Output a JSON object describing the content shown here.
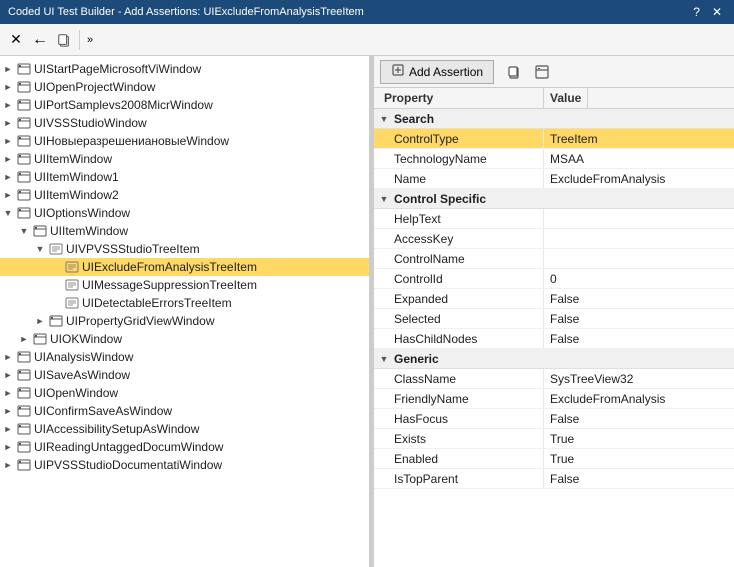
{
  "titleBar": {
    "text": "Coded UI Test Builder - Add Assertions: UIExcludeFromAnalysisTreeItem",
    "helpBtn": "?",
    "closeBtn": "✕"
  },
  "toolbar": {
    "buttons": [
      {
        "name": "cross-icon",
        "icon": "✕",
        "tooltip": "Delete"
      },
      {
        "name": "back-icon",
        "icon": "←",
        "tooltip": "Back"
      },
      {
        "name": "add-icon",
        "icon": "📋",
        "tooltip": "Add"
      },
      {
        "name": "more-icon",
        "icon": "»",
        "tooltip": "More"
      }
    ]
  },
  "treePanel": {
    "items": [
      {
        "id": "t1",
        "label": "UIStartPageMicrosoftViWindow",
        "indent": 0,
        "expander": "►",
        "icon": "win"
      },
      {
        "id": "t2",
        "label": "UIOpenProjectWindow",
        "indent": 0,
        "expander": "►",
        "icon": "win"
      },
      {
        "id": "t3",
        "label": "UIPortSamplevs2008MicrWindow",
        "indent": 0,
        "expander": "►",
        "icon": "win"
      },
      {
        "id": "t4",
        "label": "UIVSSStudioWindow",
        "indent": 0,
        "expander": "►",
        "icon": "win"
      },
      {
        "id": "t5",
        "label": "UIНовыеразрешениановыеWindow",
        "indent": 0,
        "expander": "►",
        "icon": "win"
      },
      {
        "id": "t6",
        "label": "UIItemWindow",
        "indent": 0,
        "expander": "►",
        "icon": "win"
      },
      {
        "id": "t7",
        "label": "UIItemWindow1",
        "indent": 0,
        "expander": "►",
        "icon": "win"
      },
      {
        "id": "t8",
        "label": "UIItemWindow2",
        "indent": 0,
        "expander": "►",
        "icon": "win"
      },
      {
        "id": "t9",
        "label": "UIOptionsWindow",
        "indent": 0,
        "expander": "▼",
        "icon": "win"
      },
      {
        "id": "t10",
        "label": "UIItemWindow",
        "indent": 1,
        "expander": "▼",
        "icon": "win"
      },
      {
        "id": "t11",
        "label": "UIVPVSSStudioTreeItem",
        "indent": 2,
        "expander": "▼",
        "icon": "item"
      },
      {
        "id": "t12",
        "label": "UIExcludeFromAnalysisTreeItem",
        "indent": 3,
        "expander": "",
        "icon": "item",
        "selected": true
      },
      {
        "id": "t13",
        "label": "UIMessageSuppressionTreeItem",
        "indent": 3,
        "expander": "",
        "icon": "item"
      },
      {
        "id": "t14",
        "label": "UIDetectableErrorsTreeItem",
        "indent": 3,
        "expander": "",
        "icon": "item"
      },
      {
        "id": "t15",
        "label": "UIPropertyGridViewWindow",
        "indent": 2,
        "expander": "►",
        "icon": "win"
      },
      {
        "id": "t16",
        "label": "UIOKWindow",
        "indent": 1,
        "expander": "►",
        "icon": "win"
      },
      {
        "id": "t17",
        "label": "UIAnalysisWindow",
        "indent": 0,
        "expander": "►",
        "icon": "win"
      },
      {
        "id": "t18",
        "label": "UISaveAsWindow",
        "indent": 0,
        "expander": "►",
        "icon": "win"
      },
      {
        "id": "t19",
        "label": "UIOpenWindow",
        "indent": 0,
        "expander": "►",
        "icon": "win"
      },
      {
        "id": "t20",
        "label": "UIConfirmSaveAsWindow",
        "indent": 0,
        "expander": "►",
        "icon": "win"
      },
      {
        "id": "t21",
        "label": "UIAccessibilitySetupAsWindow",
        "indent": 0,
        "expander": "►",
        "icon": "win"
      },
      {
        "id": "t22",
        "label": "UIReadingUntaggedDocumWindow",
        "indent": 0,
        "expander": "►",
        "icon": "win"
      },
      {
        "id": "t23",
        "label": "UIPVSSStudioDocumentatiWindow",
        "indent": 0,
        "expander": "►",
        "icon": "win"
      }
    ]
  },
  "rightPanel": {
    "addAssertionLabel": "Add Assertion",
    "columns": [
      {
        "label": "Property"
      },
      {
        "label": "Value"
      }
    ],
    "groups": [
      {
        "name": "Search",
        "expander": "▼",
        "rows": [
          {
            "property": "ControlType",
            "value": "TreeItem",
            "highlighted": true
          },
          {
            "property": "TechnologyName",
            "value": "MSAA",
            "highlighted": false
          },
          {
            "property": "Name",
            "value": "ExcludeFromAnalysis",
            "highlighted": false
          }
        ]
      },
      {
        "name": "Control Specific",
        "expander": "▼",
        "rows": [
          {
            "property": "HelpText",
            "value": "",
            "highlighted": false
          },
          {
            "property": "AccessKey",
            "value": "",
            "highlighted": false
          },
          {
            "property": "ControlName",
            "value": "",
            "highlighted": false
          },
          {
            "property": "ControlId",
            "value": "0",
            "highlighted": false
          },
          {
            "property": "Expanded",
            "value": "False",
            "highlighted": false
          },
          {
            "property": "Selected",
            "value": "False",
            "highlighted": false
          },
          {
            "property": "HasChildNodes",
            "value": "False",
            "highlighted": false
          }
        ]
      },
      {
        "name": "Generic",
        "expander": "▼",
        "rows": [
          {
            "property": "ClassName",
            "value": "SysTreeView32",
            "highlighted": false
          },
          {
            "property": "FriendlyName",
            "value": "ExcludeFromAnalysis",
            "highlighted": false
          },
          {
            "property": "HasFocus",
            "value": "False",
            "highlighted": false
          },
          {
            "property": "Exists",
            "value": "True",
            "highlighted": false
          },
          {
            "property": "Enabled",
            "value": "True",
            "highlighted": false
          },
          {
            "property": "IsTopParent",
            "value": "False",
            "highlighted": false
          }
        ]
      }
    ]
  }
}
